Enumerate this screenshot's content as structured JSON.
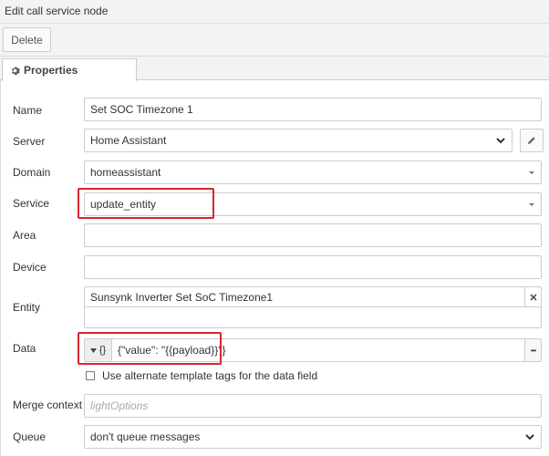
{
  "dialog": {
    "title": "Edit call service node"
  },
  "toolbar": {
    "delete_label": "Delete"
  },
  "tabs": [
    {
      "label": "Properties",
      "icon": "gear-icon"
    }
  ],
  "form": {
    "name": {
      "label": "Name",
      "value": "Set SOC Timezone 1"
    },
    "server": {
      "label": "Server",
      "value": "Home Assistant",
      "icon": "pencil-icon"
    },
    "domain": {
      "label": "Domain",
      "value": "homeassistant"
    },
    "service": {
      "label": "Service",
      "value": "update_entity"
    },
    "area": {
      "label": "Area",
      "value": ""
    },
    "device": {
      "label": "Device",
      "value": ""
    },
    "entity": {
      "label": "Entity",
      "value": "Sunsynk Inverter Set SoC Timezone1",
      "clear_icon": "close-icon"
    },
    "data": {
      "label": "Data",
      "type_glyph": "{}",
      "value": "{\"value\": \"{{payload}}\"}",
      "expand_glyph": "•••"
    },
    "alt_tags": {
      "label": "Use alternate template tags for the data field",
      "checked": false
    },
    "merge_context": {
      "label": "Merge context",
      "placeholder": "lightOptions"
    },
    "queue": {
      "label": "Queue",
      "value": "don't queue messages"
    }
  },
  "colors": {
    "highlight": "#d9242c",
    "border": "#cccccc",
    "toolbar_bg": "#f3f3f3"
  }
}
